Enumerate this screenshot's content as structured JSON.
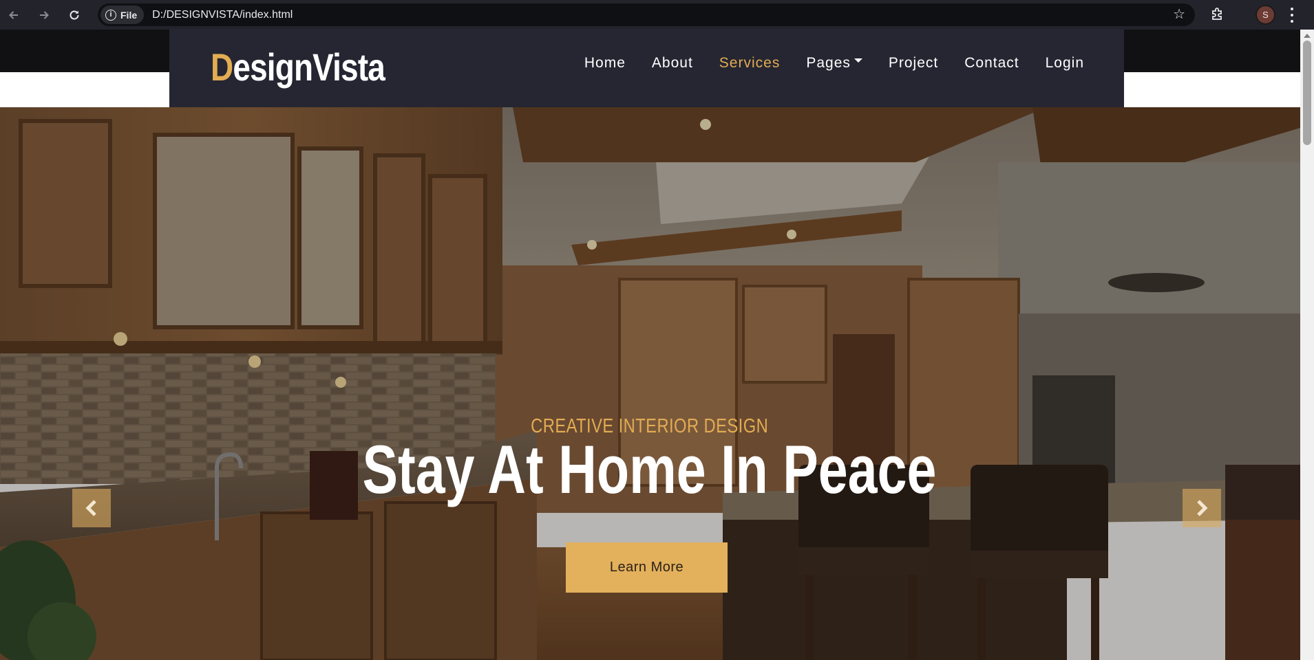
{
  "browser": {
    "file_chip_label": "File",
    "url": "D:/DESIGNVISTA/index.html",
    "profile_initial": "S",
    "icons": [
      "back-icon",
      "forward-icon",
      "reload-icon",
      "info-icon",
      "star-icon",
      "extensions-icon",
      "kebab-menu-icon"
    ]
  },
  "navbar": {
    "logo_first_letter": "D",
    "logo_rest": "esignVista",
    "menu": [
      {
        "label": "Home"
      },
      {
        "label": "About"
      },
      {
        "label": "Services",
        "active": true
      },
      {
        "label": "Pages",
        "dropdown": true
      },
      {
        "label": "Project"
      },
      {
        "label": "Contact"
      },
      {
        "label": "Login"
      }
    ]
  },
  "hero": {
    "subtitle": "CREATIVE INTERIOR DESIGN",
    "title": "Stay At Home In Peace",
    "cta_label": "Learn More",
    "prev_icon": "chevron-left-icon",
    "next_icon": "chevron-right-icon"
  },
  "colors": {
    "accent": "#e3ac53",
    "navbar_bg": "#252632",
    "topbar_bg": "#111113",
    "cta_bg": "#e3b05c"
  }
}
